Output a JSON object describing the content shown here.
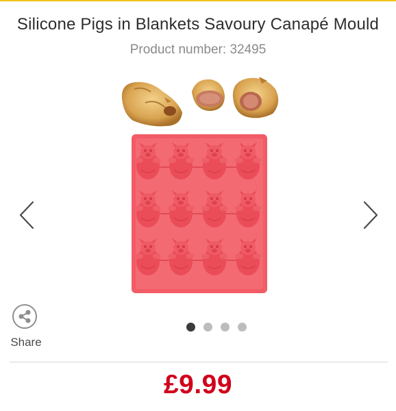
{
  "product": {
    "title": "Silicone Pigs in Blankets Savoury Canapé Mould",
    "product_number": "Product number: 32495",
    "price": "£9.99"
  },
  "gallery": {
    "prev_icon": "chevron-left-icon",
    "next_icon": "chevron-right-icon",
    "dots": [
      {
        "active": true
      },
      {
        "active": false
      },
      {
        "active": false
      },
      {
        "active": false
      }
    ]
  },
  "share": {
    "label": "Share",
    "icon": "share-icon"
  },
  "colors": {
    "price": "#d0021b",
    "mould": "#f25c66",
    "accent_rule": "#f0c419"
  }
}
